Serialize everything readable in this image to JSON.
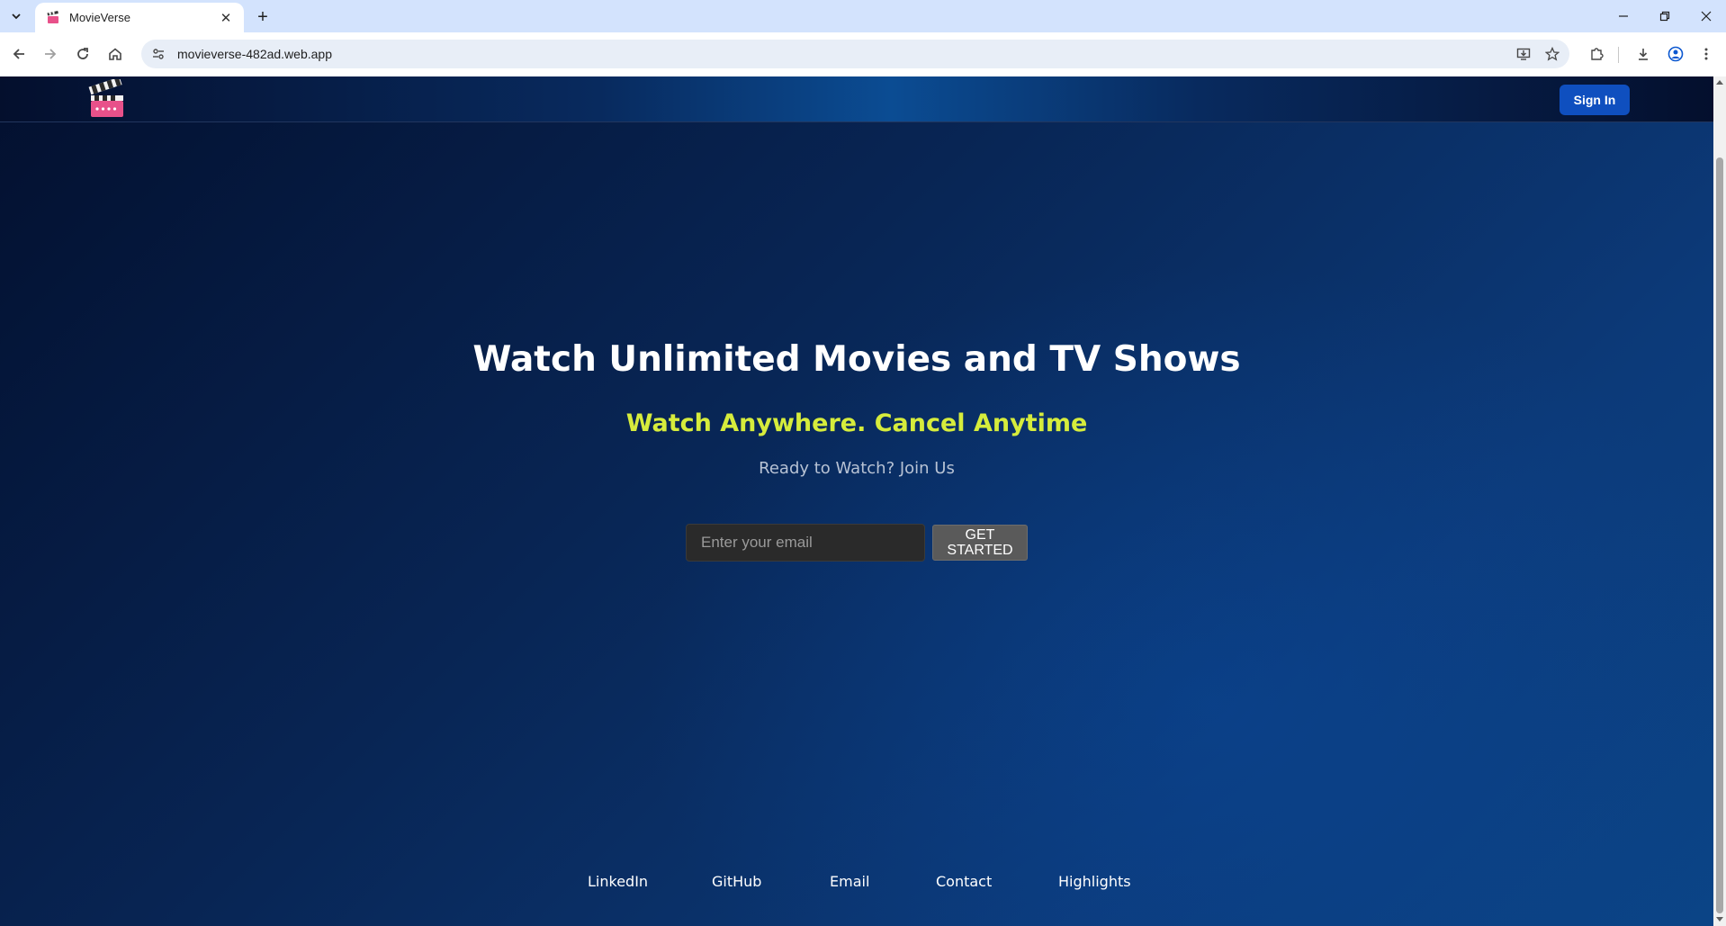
{
  "browser": {
    "tab_title": "MovieVerse",
    "url": "movieverse-482ad.web.app"
  },
  "icons": {
    "tab_list": "chevron-down-icon",
    "tab_favicon": "clapperboard-icon",
    "tab_close": "close-icon",
    "new_tab": "plus-icon",
    "minimize": "minimize-icon",
    "restore": "restore-icon",
    "window_close": "close-icon",
    "back": "arrow-left-icon",
    "forward": "arrow-right-icon",
    "reload": "reload-icon",
    "home": "home-icon",
    "site_info": "tune-icon",
    "install": "install-app-icon",
    "bookmark": "star-icon",
    "extensions": "puzzle-icon",
    "downloads": "download-icon",
    "profile": "profile-icon",
    "menu": "kebab-menu-icon",
    "logo": "clapperboard-icon"
  },
  "colors": {
    "accent_button": "#0f4fbf",
    "subtitle": "#d6ec3c",
    "page_background": "#082554",
    "tab_bar": "#d3e3fd"
  },
  "header": {
    "sign_in_label": "Sign In"
  },
  "hero": {
    "title": "Watch Unlimited Movies and TV Shows",
    "subtitle": "Watch Anywhere. Cancel Anytime",
    "cta_text": "Ready to Watch? Join Us",
    "email_placeholder": "Enter your email",
    "email_value": "",
    "get_started_label": "GET\nSTARTED"
  },
  "footer": {
    "links": [
      "LinkedIn",
      "GitHub",
      "Email",
      "Contact",
      "Highlights"
    ]
  }
}
